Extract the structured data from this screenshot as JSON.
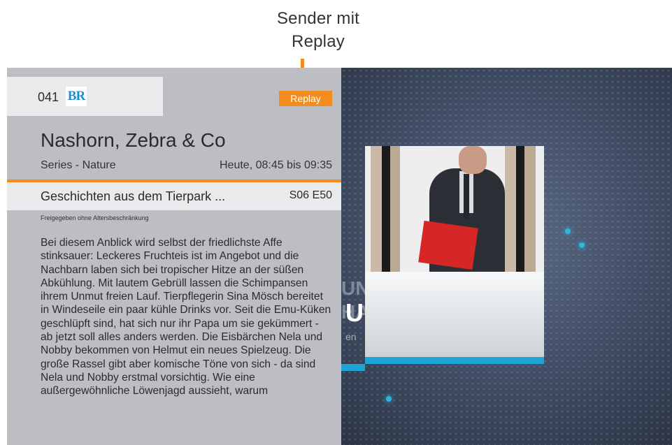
{
  "callout": {
    "line1": "Sender mit",
    "line2": "Replay"
  },
  "channel": {
    "number": "041",
    "logo_text": "BR",
    "badge": "Replay"
  },
  "program": {
    "title": "Nashorn, Zebra & Co",
    "genre": "Series - Nature",
    "time": "Heute, 08:45 bis 09:35",
    "episode_title": "Geschichten aus dem Tierpark ...",
    "episode_code": "S06 E50",
    "rating": "Freigegeben ohne Altersbeschränkung",
    "description": "Bei diesem Anblick wird selbst der friedlichste Affe stinksauer: Leckeres Fruchteis ist im Angebot und die Nachbarn laben sich bei tropischer Hitze an der süßen Abkühlung. Mit lautem Gebrüll lassen die Schimpansen ihrem Unmut freien Lauf. Tierpflegerin Sina Mösch bereitet in Windeseile ein paar kühle Drinks vor. Seit die Emu-Küken geschlüpft sind, hat sich nur ihr Papa um sie gekümmert - ab jetzt soll alles anders werden. Die Eisbärchen Nela und Nobby bekommen von Helmut ein neues Spielzeug. Die große Rassel gibt aber komische Töne von sich - da sind Nela und Nobby erstmal vorsichtig. Wie eine außergewöhnliche Löwenjagd aussieht, warum"
  },
  "tv": {
    "logo_partial_1": "UND",
    "logo_partial_2": "HAU",
    "logo_letter": "U",
    "logo_sub": "en"
  },
  "colors": {
    "accent": "#f28c1e",
    "panel_bg": "#bcbec3",
    "row_bg": "#e9eaec",
    "tv_blue": "#1fa4d6"
  }
}
